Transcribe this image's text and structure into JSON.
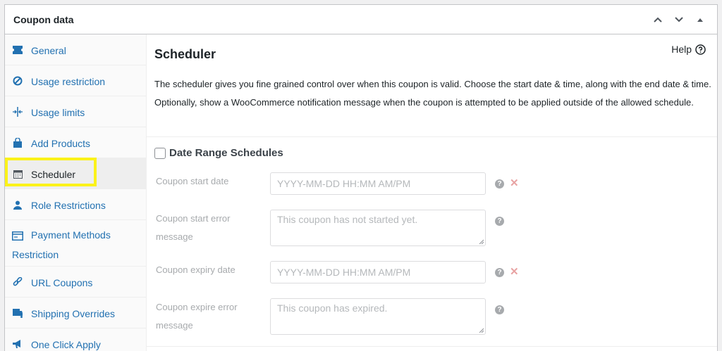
{
  "panel": {
    "title": "Coupon data"
  },
  "tabs": [
    {
      "label": "General",
      "icon": "ticket-icon"
    },
    {
      "label": "Usage restriction",
      "icon": "block-icon"
    },
    {
      "label": "Usage limits",
      "icon": "limits-icon"
    },
    {
      "label": "Add Products",
      "icon": "cart-icon"
    },
    {
      "label": "Scheduler",
      "icon": "calendar-icon"
    },
    {
      "label": "Role Restrictions",
      "icon": "user-icon"
    },
    {
      "label": "Payment Methods",
      "label2": "Restriction",
      "icon": "card-icon"
    },
    {
      "label": "URL Coupons",
      "icon": "link-icon"
    },
    {
      "label": "Shipping Overrides",
      "icon": "truck-icon"
    },
    {
      "label": "One Click Apply",
      "icon": "megaphone-icon"
    }
  ],
  "scheduler": {
    "title": "Scheduler",
    "help": "Help",
    "description": "The scheduler gives you fine grained control over when this coupon is valid. Choose the start date & time, along with the end date & time. Optionally, show a WooCommerce notification message when the coupon is attempted to be applied outside of the allowed schedule.",
    "date_range_label": "Date Range Schedules",
    "fields": {
      "start_date_label": "Coupon start date",
      "start_date_placeholder": "YYYY-MM-DD HH:MM AM/PM",
      "start_error_label_1": "Coupon start error",
      "start_error_label_2": "message",
      "start_error_placeholder": "This coupon has not started yet.",
      "expiry_date_label": "Coupon expiry date",
      "expiry_date_placeholder": "YYYY-MM-DD HH:MM AM/PM",
      "expire_error_label_1": "Coupon expire error",
      "expire_error_label_2": "message",
      "expire_error_placeholder": "This coupon has expired."
    }
  },
  "colors": {
    "link": "#2271b1",
    "highlight": "#fbf21a",
    "remove": "#e8a3a3"
  }
}
